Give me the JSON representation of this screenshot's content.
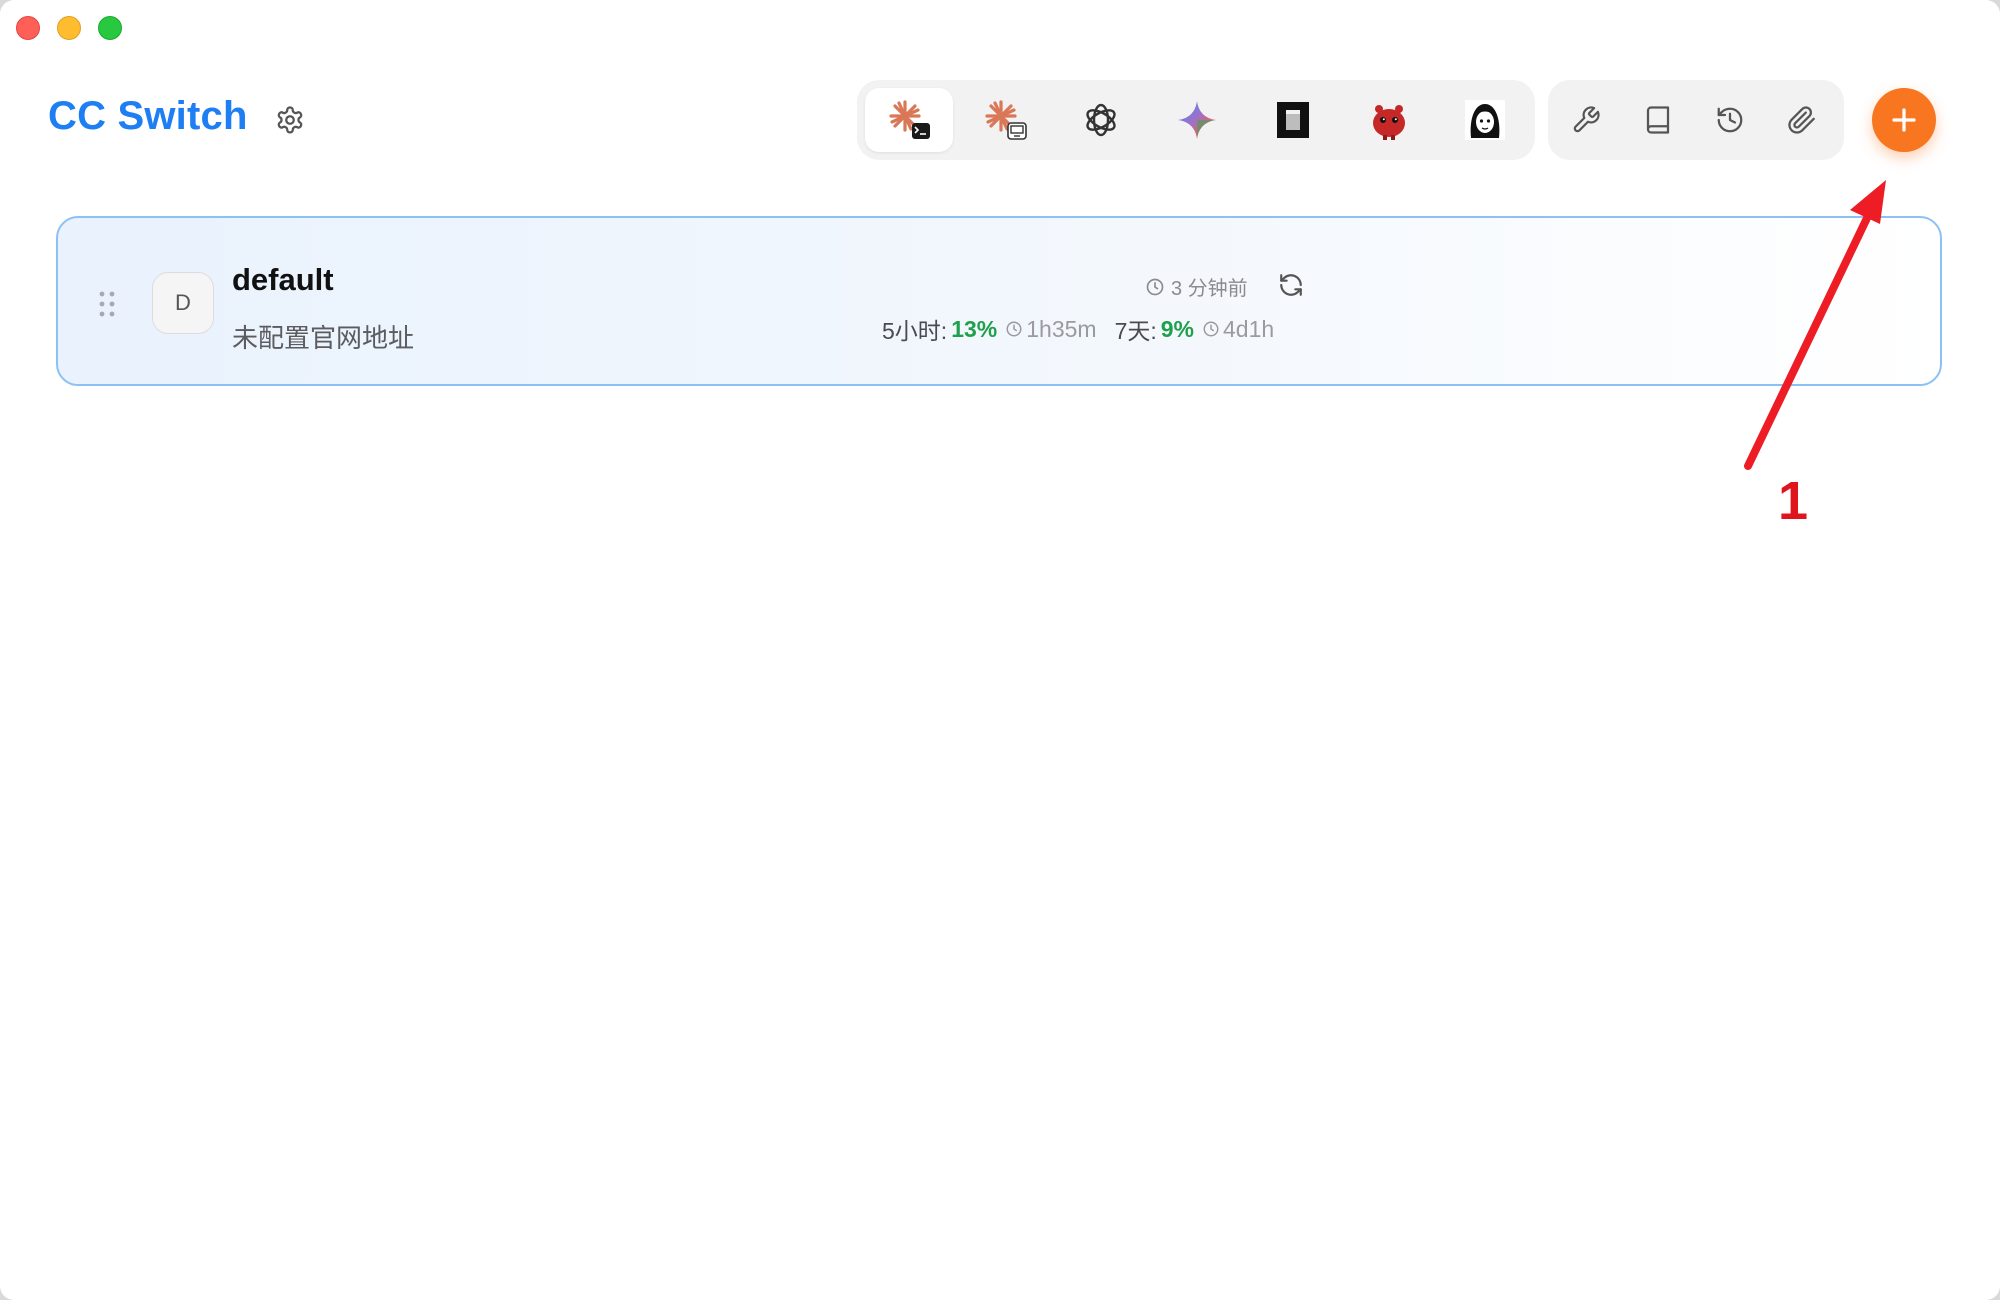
{
  "app": {
    "title": "CC Switch"
  },
  "apps": [
    {
      "name": "claude-code-icon",
      "active": true
    },
    {
      "name": "claude-desktop-icon",
      "active": false
    },
    {
      "name": "openai-icon",
      "active": false
    },
    {
      "name": "gemini-icon",
      "active": false
    },
    {
      "name": "terminal-app-icon",
      "active": false
    },
    {
      "name": "red-bot-icon",
      "active": false
    },
    {
      "name": "avatar-girl-icon",
      "active": false
    }
  ],
  "tools": [
    "wrench-icon",
    "book-icon",
    "history-icon",
    "paperclip-icon"
  ],
  "provider": {
    "avatar_letter": "D",
    "name": "default",
    "subtitle": "未配置官网地址",
    "updated": "3 分钟前",
    "usage": {
      "five_hour_label": "5小时:",
      "five_hour_pct": "13%",
      "five_hour_reset": "1h35m",
      "seven_day_label": "7天:",
      "seven_day_pct": "9%",
      "seven_day_reset": "4d1h"
    }
  },
  "annotation": {
    "label": "1"
  },
  "colors": {
    "accent": "#1e7ef3",
    "add_button": "#f87620",
    "usage_ok": "#1fa04a",
    "annotation": "#e0141c"
  }
}
